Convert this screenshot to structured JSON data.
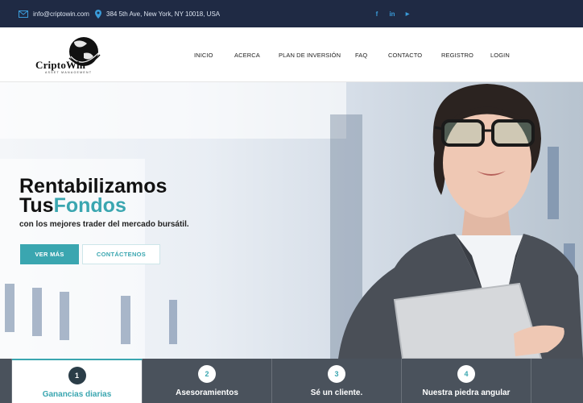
{
  "topbar": {
    "email": "info@criptowin.com",
    "address": "384 5th Ave, New York, NY 10018, USA",
    "social": [
      {
        "icon": "facebook-icon",
        "label": "f"
      },
      {
        "icon": "linkedin-icon",
        "label": "in"
      },
      {
        "icon": "youtube-icon",
        "label": "▶"
      }
    ]
  },
  "brand": {
    "name": "CriptoWin",
    "tagline": "ASSET MANAGEMENT"
  },
  "nav": {
    "items": [
      "INICIO",
      "ACERCA",
      "PLAN DE INVERSIÓN",
      "FAQ",
      "CONTACTO",
      "REGISTRO",
      "LOGIN"
    ]
  },
  "hero": {
    "title_line1": "Rentabilizamos",
    "title_line2_plain": "Tus",
    "title_line2_accent": "Fondos",
    "subtitle": "con los mejores trader del mercado bursátil.",
    "btn_more": "VER MÁS",
    "btn_contact": "CONTÁCTENOS"
  },
  "tabs": [
    {
      "num": "1",
      "label": "Ganancias diarias",
      "active": true
    },
    {
      "num": "2",
      "label": "Asesoramientos",
      "active": false
    },
    {
      "num": "3",
      "label": "Sé un cliente.",
      "active": false
    },
    {
      "num": "4",
      "label": "Nuestra piedra angular",
      "active": false
    }
  ],
  "colors": {
    "accent": "#3aa6b0",
    "topbar_bg": "#1f2a44",
    "tabs_bg": "#4a525c"
  }
}
